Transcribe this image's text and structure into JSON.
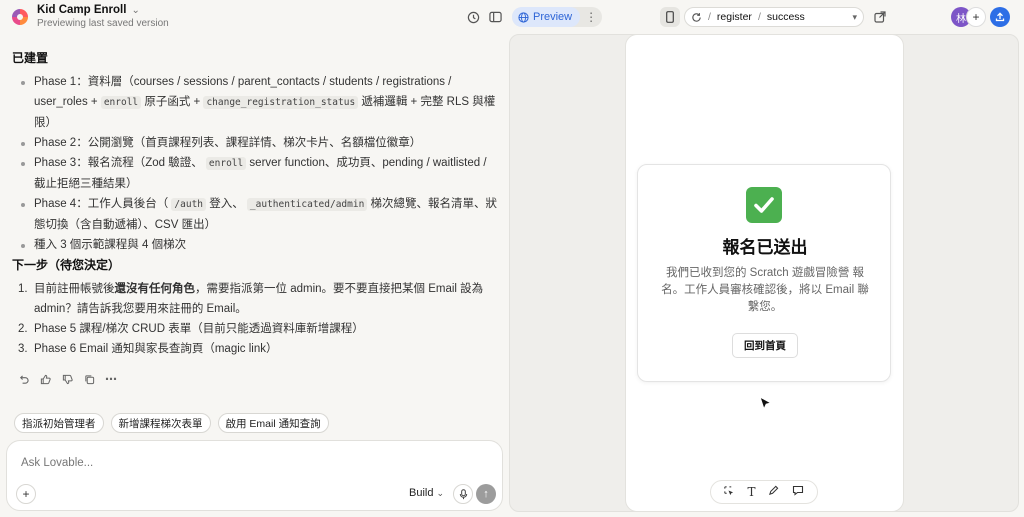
{
  "topbar": {
    "project_name": "Kid Camp Enroll",
    "project_subtitle": "Previewing last saved version",
    "preview_label": "Preview",
    "url_path": [
      "register",
      "success"
    ],
    "avatar_initial": "林"
  },
  "chat": {
    "built_heading": "已建置",
    "built_items": [
      [
        "Phase 1：資料層（courses / sessions / parent_contacts / students / registrations / user_roles + ",
        "enroll",
        " 原子函式 + ",
        "change_registration_status",
        " 遞補邏輯 + 完整 RLS 與權限）"
      ],
      [
        "Phase 2：公開瀏覽（首頁課程列表、課程詳情、梯次卡片、名額檔位徽章）"
      ],
      [
        "Phase 3：報名流程（Zod 驗證、 ",
        "enroll",
        " server function、成功頁、pending / waitlisted / 截止拒絕三種結果）"
      ],
      [
        "Phase 4：工作人員後台（ ",
        "/auth",
        " 登入、 ",
        "_authenticated/admin",
        " 梯次總覽、報名清單、狀態切換（含自動遞補）、CSV 匯出）"
      ],
      [
        "種入 3 個示範課程與 4 個梯次"
      ]
    ],
    "next_heading": "下一步（待您決定）",
    "next_items": [
      {
        "num": "1.",
        "pre": "目前註冊帳號後",
        "bold": "還沒有任何角色",
        "post": "，需要指派第一位 admin。要不要直接把某個 Email 設為 admin？請告訴我您要用來註冊的 Email。"
      },
      {
        "num": "2.",
        "pre": "Phase 5 課程/梯次 CRUD 表單（目前只能透過資料庫新增課程）",
        "bold": "",
        "post": ""
      },
      {
        "num": "3.",
        "pre": "Phase 6 Email 通知與家長查詢頁（magic link）",
        "bold": "",
        "post": ""
      }
    ],
    "chips": [
      "指派初始管理者",
      "新增課程梯次表單",
      "啟用 Email 通知查詢"
    ],
    "composer_placeholder": "Ask Lovable...",
    "build_label": "Build"
  },
  "preview": {
    "success_title": "報名已送出",
    "success_message": "我們已收到您的 Scratch 遊戲冒險營 報名。工作人員審核確認後，將以 Email 聯繫您。",
    "home_button": "回到首頁"
  },
  "colors": {
    "accent": "#2d64d6",
    "check": "#4cb050",
    "avatar": "#7d55c7"
  }
}
